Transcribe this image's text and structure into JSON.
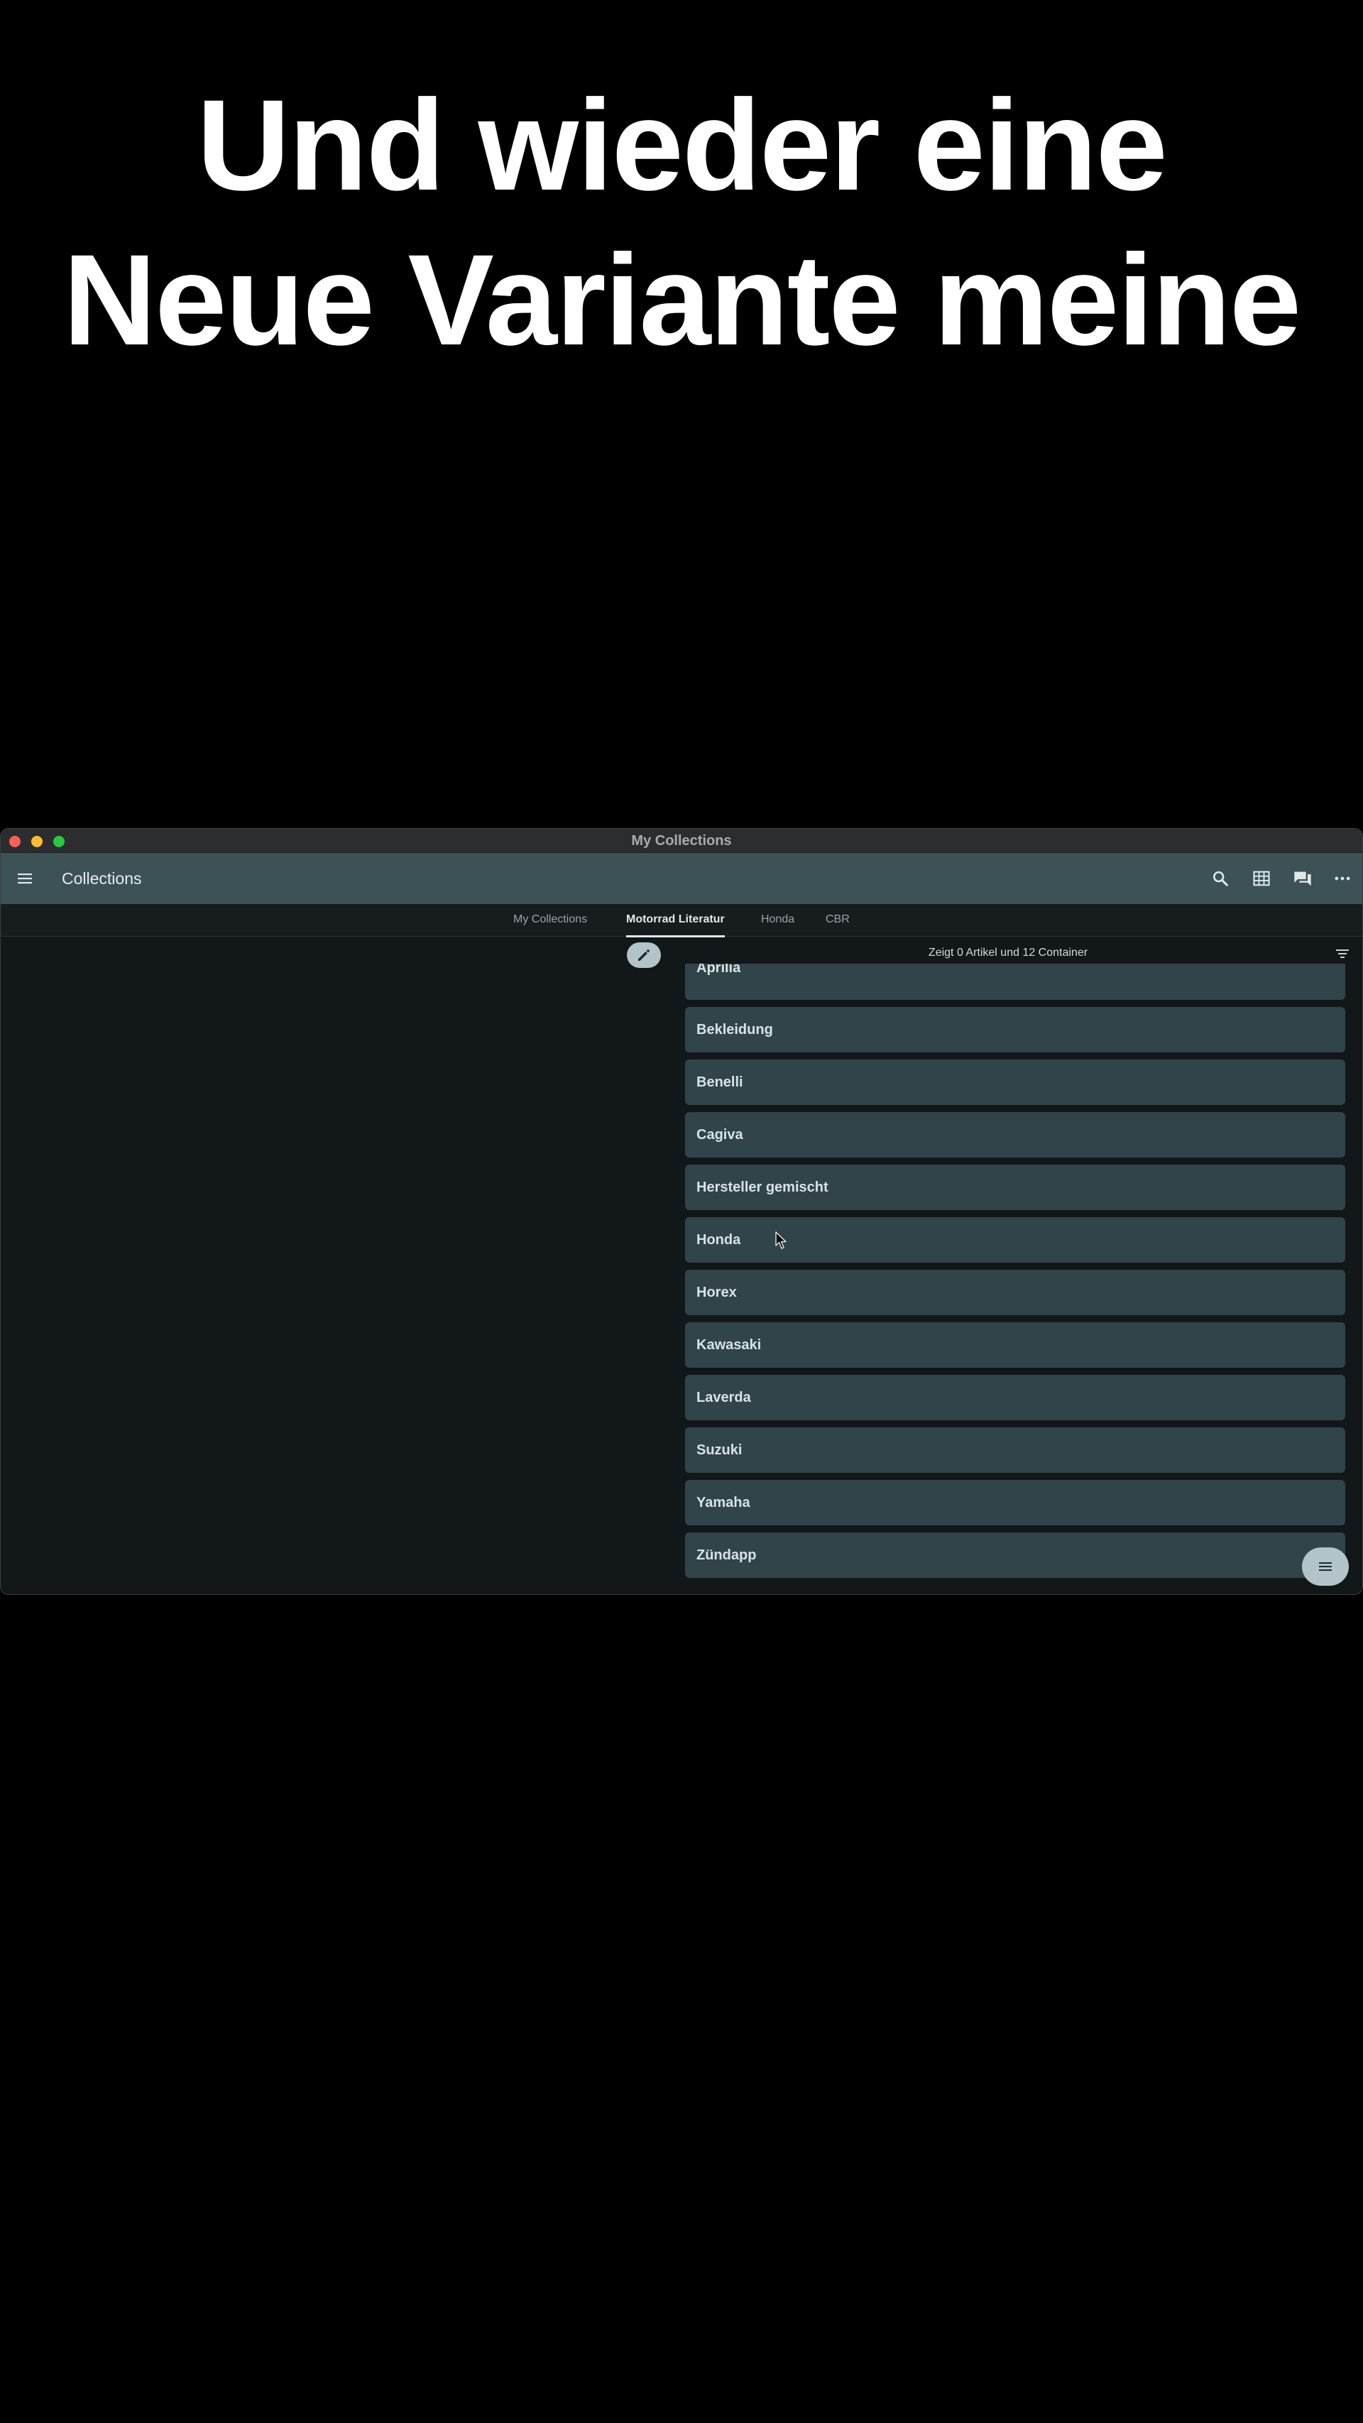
{
  "caption": {
    "line1": "Und wieder eine",
    "line2": "Neue Variante meine"
  },
  "window": {
    "title": "My Collections"
  },
  "appbar": {
    "title": "Collections",
    "icons": [
      "menu-icon",
      "search-icon",
      "grid-icon",
      "chat-icon",
      "more-icon"
    ]
  },
  "tabs": [
    {
      "label": "My Collections",
      "active": false
    },
    {
      "label": "Motorrad Literatur",
      "active": true
    },
    {
      "label": "Honda",
      "active": false
    },
    {
      "label": "CBR",
      "active": false
    }
  ],
  "status": {
    "text": "Zeigt 0 Artikel und 12 Container"
  },
  "list": {
    "items": [
      "Aprilia",
      "Bekleidung",
      "Benelli",
      "Cagiva",
      "Hersteller gemischt",
      "Honda",
      "Horex",
      "Kawasaki",
      "Laverda",
      "Suzuki",
      "Yamaha",
      "Zündapp"
    ]
  },
  "colors": {
    "appbar": "#3d5257",
    "list_item": "#30444a",
    "fab": "#b3c4c9",
    "background": "#121719"
  }
}
